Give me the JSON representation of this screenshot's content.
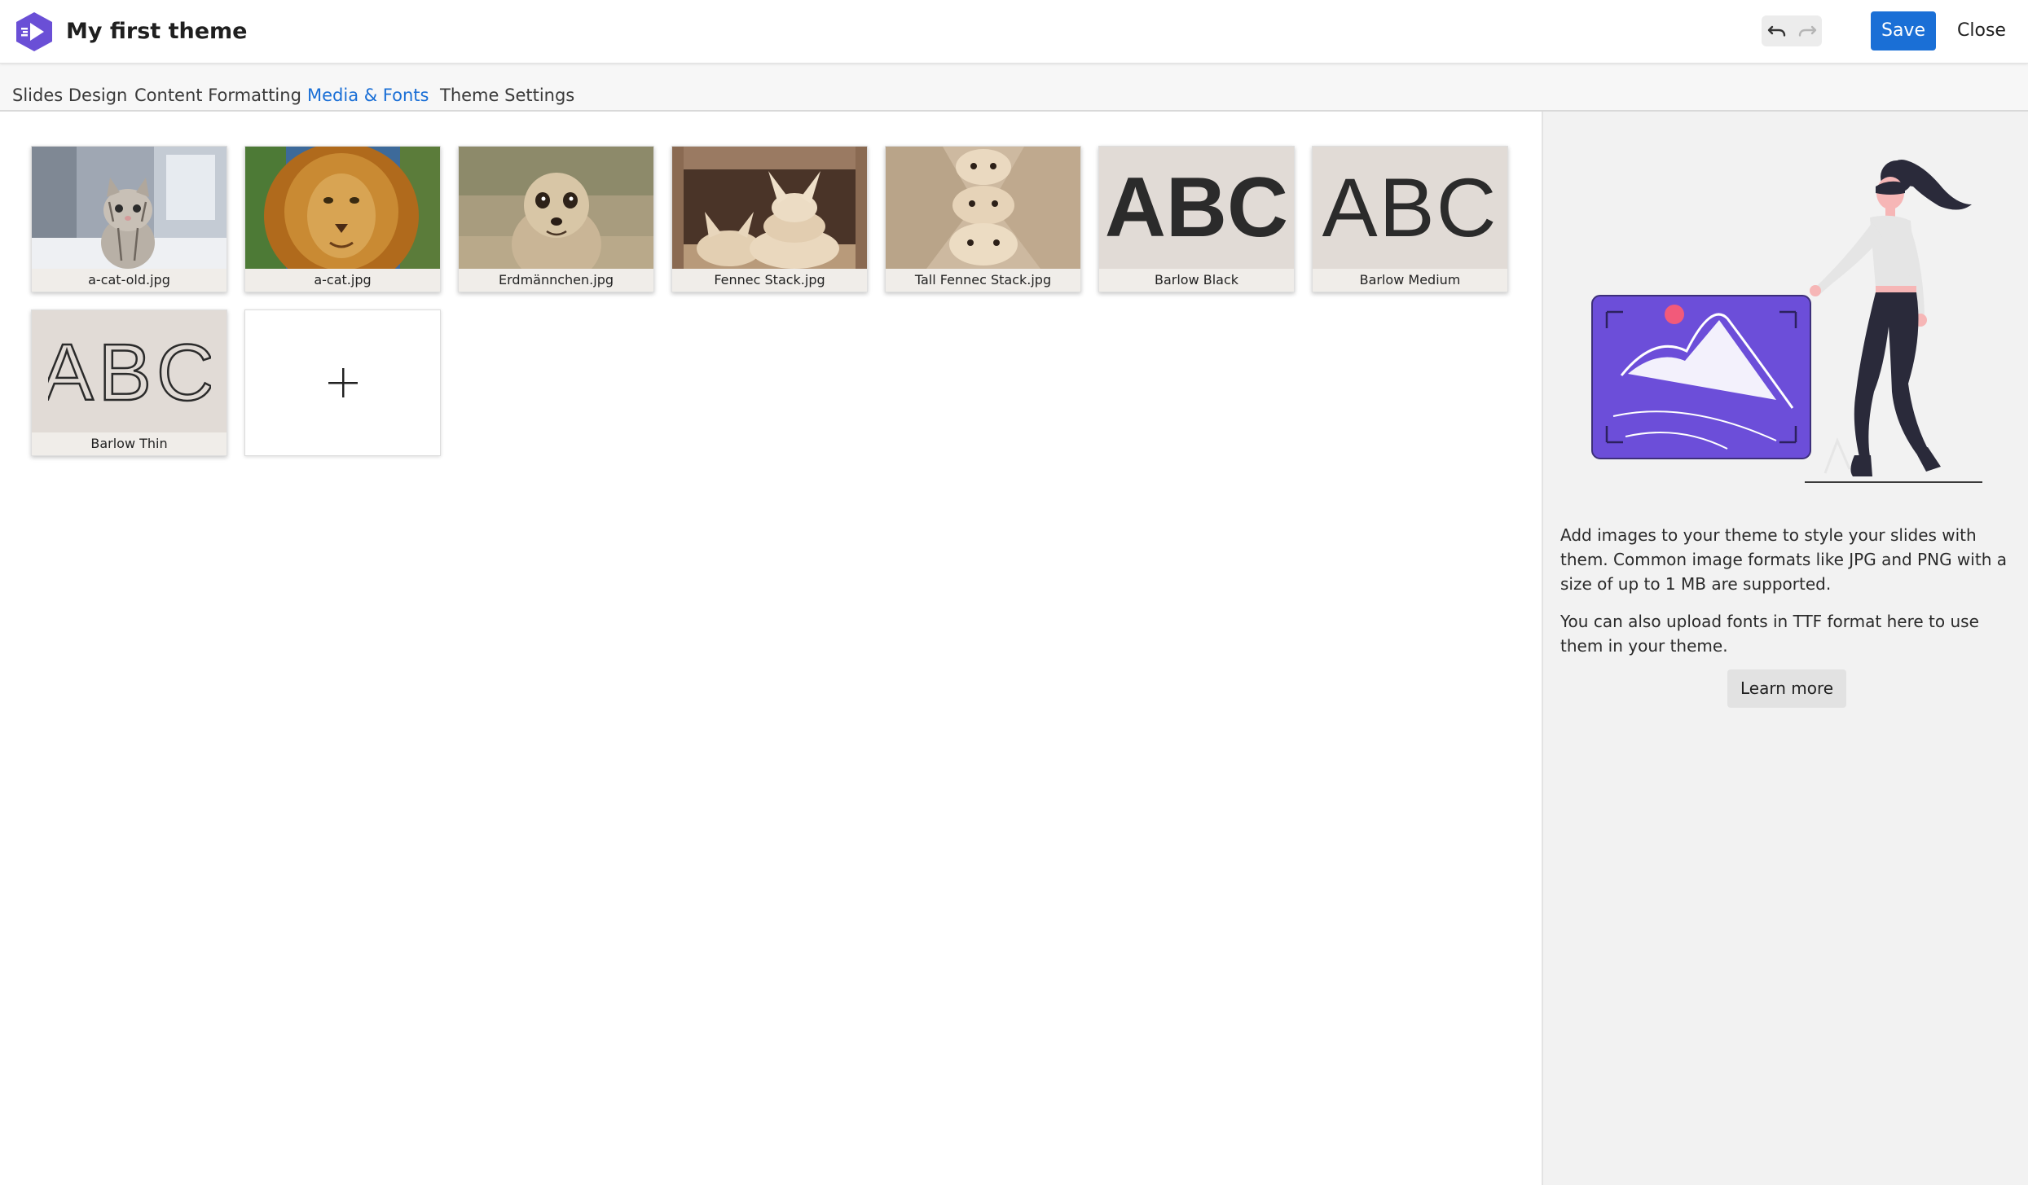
{
  "app": {
    "title": "My first theme",
    "accent_color": "#1a6fd6",
    "logo_color": "#6a4fd6"
  },
  "toolbar": {
    "undo_icon": "undo-icon",
    "redo_icon": "redo-icon",
    "save_label": "Save",
    "close_label": "Close"
  },
  "tabs": [
    {
      "label": "Slides Design",
      "active": false
    },
    {
      "label": "Content Formatting",
      "active": false
    },
    {
      "label": "Media & Fonts",
      "active": true
    },
    {
      "label": "Theme Settings",
      "active": false
    }
  ],
  "media": [
    {
      "caption": "a-cat-old.jpg",
      "kind": "image"
    },
    {
      "caption": "a-cat.jpg",
      "kind": "image"
    },
    {
      "caption": "Erdmännchen.jpg",
      "kind": "image"
    },
    {
      "caption": "Fennec Stack.jpg",
      "kind": "image"
    },
    {
      "caption": "Tall Fennec Stack.jpg",
      "kind": "image"
    },
    {
      "caption": "Barlow Black",
      "kind": "font",
      "sample": "ABC",
      "weight": "black"
    },
    {
      "caption": "Barlow Medium",
      "kind": "font",
      "sample": "ABC",
      "weight": "medium"
    },
    {
      "caption": "Barlow Thin",
      "kind": "font",
      "sample": "ABC",
      "weight": "thin"
    }
  ],
  "add_tile": {
    "icon": "plus-icon"
  },
  "side": {
    "paragraph1": "Add images to your theme to style your slides with them. Common image formats like JPG and PNG with a size of up to 1 MB are supported.",
    "paragraph2": "You can also upload fonts in TTF format here to use them in your theme.",
    "learn_more_label": "Learn more",
    "illustration_color": "#6c4ed9"
  }
}
